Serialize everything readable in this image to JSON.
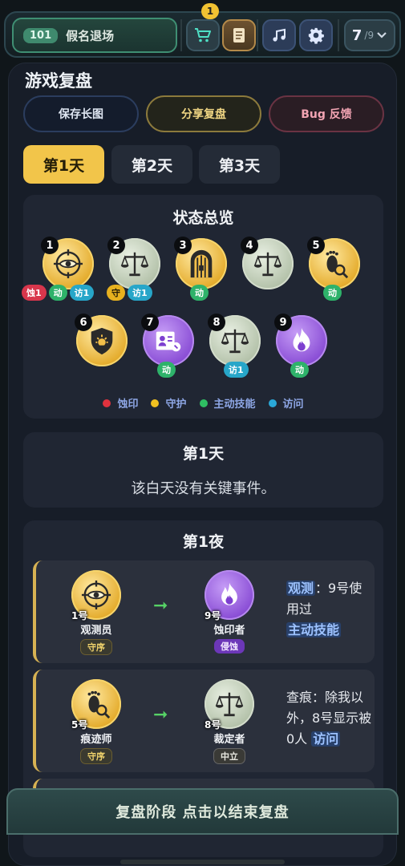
{
  "header": {
    "player_id": "101",
    "player_name": "假名退场",
    "cart_badge": "1",
    "counter_value": "7",
    "counter_total": "/9"
  },
  "panel": {
    "title": "游戏复盘",
    "actions": {
      "save": "保存长图",
      "share": "分享复盘",
      "bug": "Bug 反馈"
    },
    "day_tabs": [
      "第1天",
      "第2天",
      "第3天"
    ],
    "active_tab": "第1天"
  },
  "status": {
    "title": "状态总览",
    "players": [
      {
        "num": "1",
        "color": "gold",
        "icon": "eye-target-icon",
        "tags": [
          [
            "蚀1",
            "red"
          ],
          [
            "动",
            "green"
          ],
          [
            "访1",
            "cyan"
          ]
        ]
      },
      {
        "num": "2",
        "color": "silver",
        "icon": "scales-icon",
        "tags": [
          [
            "守",
            "yellow"
          ],
          [
            "访1",
            "cyan"
          ]
        ]
      },
      {
        "num": "3",
        "color": "gold",
        "icon": "gate-icon",
        "tags": [
          [
            "动",
            "green"
          ]
        ]
      },
      {
        "num": "4",
        "color": "silver",
        "icon": "scales-icon",
        "tags": []
      },
      {
        "num": "5",
        "color": "gold",
        "icon": "footprint-search-icon",
        "tags": [
          [
            "动",
            "green"
          ]
        ]
      },
      {
        "num": "6",
        "color": "gold",
        "icon": "shield-sun-icon",
        "tags": []
      },
      {
        "num": "7",
        "color": "purple",
        "icon": "id-card-icon",
        "tags": [
          [
            "动",
            "green"
          ]
        ]
      },
      {
        "num": "8",
        "color": "silver",
        "icon": "scales-icon",
        "tags": [
          [
            "访1",
            "cyan"
          ]
        ]
      },
      {
        "num": "9",
        "color": "purple",
        "icon": "flame-icon",
        "tags": [
          [
            "动",
            "green"
          ]
        ]
      }
    ],
    "legend": [
      {
        "label": "蚀印",
        "color": "#e0323e"
      },
      {
        "label": "守护",
        "color": "#f0c020"
      },
      {
        "label": "主动技能",
        "color": "#2fbf63"
      },
      {
        "label": "访问",
        "color": "#2aa8d8"
      }
    ]
  },
  "day1": {
    "title": "第1天",
    "message": "该白天没有关键事件。"
  },
  "night1": {
    "title": "第1夜",
    "events": [
      {
        "from": {
          "num": "1号",
          "name": "观测员",
          "tag": "守序"
        },
        "to": {
          "num": "9号",
          "name": "蚀印者",
          "tag": "侵蚀"
        },
        "text_hl1": "观测",
        "text_plain": "：9号使用过",
        "text_hl2": "主动技能"
      },
      {
        "from": {
          "num": "5号",
          "name": "痕迹师",
          "tag": "守序"
        },
        "to": {
          "num": "8号",
          "name": "裁定者",
          "tag": "中立"
        },
        "text_plain": "查痕：除我以外，8号显示被0人",
        "text_hl2": "访问"
      }
    ]
  },
  "footer": {
    "label": "复盘阶段 点击以结束复盘"
  }
}
